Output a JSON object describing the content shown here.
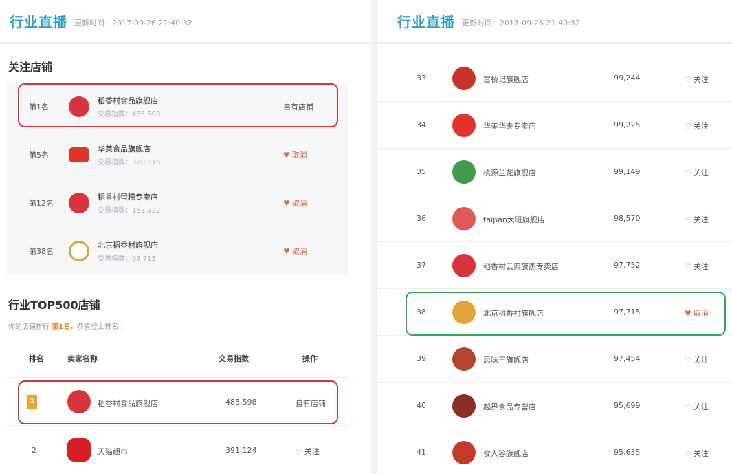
{
  "left": {
    "header": {
      "title": "行业直播",
      "time": "更新时间：2017-09-26 21:40:32"
    },
    "follow_title": "关注店铺",
    "followed": [
      {
        "rank": "第1名",
        "name": "稻香村食品旗舰店",
        "sub": "交易指数：485,598",
        "action": "自有店铺",
        "logo_color": "#d8343e",
        "cancel": false
      },
      {
        "rank": "第5名",
        "name": "华美食品旗舰店",
        "sub": "交易指数：320,016",
        "action": "取消",
        "logo_color": "#e2322a",
        "cancel": true
      },
      {
        "rank": "第12名",
        "name": "稻香村蛋糕专卖店",
        "sub": "交易指数：153,922",
        "action": "取消",
        "logo_color": "#d8343e",
        "cancel": true
      },
      {
        "rank": "第38名",
        "name": "北京稻香村旗舰店",
        "sub": "交易指数：97,715",
        "action": "取消",
        "logo_color": "#e0a23a",
        "cancel": true
      }
    ],
    "top_title": "行业TOP500店铺",
    "top_note_prefix": "你的店铺排行",
    "top_note_rank": "第1名",
    "top_note_suffix": "，恭喜登上排名！",
    "columns": {
      "rank": "排名",
      "name": "卖家名称",
      "index": "交易指数",
      "op": "操作"
    },
    "rows": [
      {
        "rank": "1",
        "name": "稻香村食品旗舰店",
        "index": "485,598",
        "action": "自有店铺",
        "logo_color": "#d8343e"
      },
      {
        "rank": "2",
        "name": "天猫超市",
        "index": "391,124",
        "action": "关注",
        "logo_color": "#d61f26"
      }
    ]
  },
  "right": {
    "header": {
      "title": "行业直播",
      "time": "更新时间：2017-09-26 21:40:32"
    },
    "rows": [
      {
        "num": "33",
        "name": "富桥记旗舰店",
        "index": "99,244",
        "action": "关注",
        "cancel": false,
        "logo_color": "#c9342a"
      },
      {
        "num": "34",
        "name": "华美华夫专卖店",
        "index": "99,225",
        "action": "关注",
        "cancel": false,
        "logo_color": "#e2322a"
      },
      {
        "num": "35",
        "name": "桃源兰花旗舰店",
        "index": "99,149",
        "action": "关注",
        "cancel": false,
        "logo_color": "#3f9a4a"
      },
      {
        "num": "36",
        "name": "taipan大班旗舰店",
        "index": "98,570",
        "action": "关注",
        "cancel": false,
        "logo_color": "#e05a5a"
      },
      {
        "num": "37",
        "name": "稻香村云典旗杰专卖店",
        "index": "97,752",
        "action": "关注",
        "cancel": false,
        "logo_color": "#d8343e"
      },
      {
        "num": "38",
        "name": "北京稻香村旗舰店",
        "index": "97,715",
        "action": "取消",
        "cancel": true,
        "logo_color": "#e0a23a"
      },
      {
        "num": "39",
        "name": "思味王旗舰店",
        "index": "97,454",
        "action": "关注",
        "cancel": false,
        "logo_color": "#b2472f"
      },
      {
        "num": "40",
        "name": "越界食品专营店",
        "index": "95,699",
        "action": "关注",
        "cancel": false,
        "logo_color": "#8a2f26"
      },
      {
        "num": "41",
        "name": "食人谷旗舰店",
        "index": "95,635",
        "action": "关注",
        "cancel": false,
        "logo_color": "#c63a2a"
      }
    ]
  }
}
